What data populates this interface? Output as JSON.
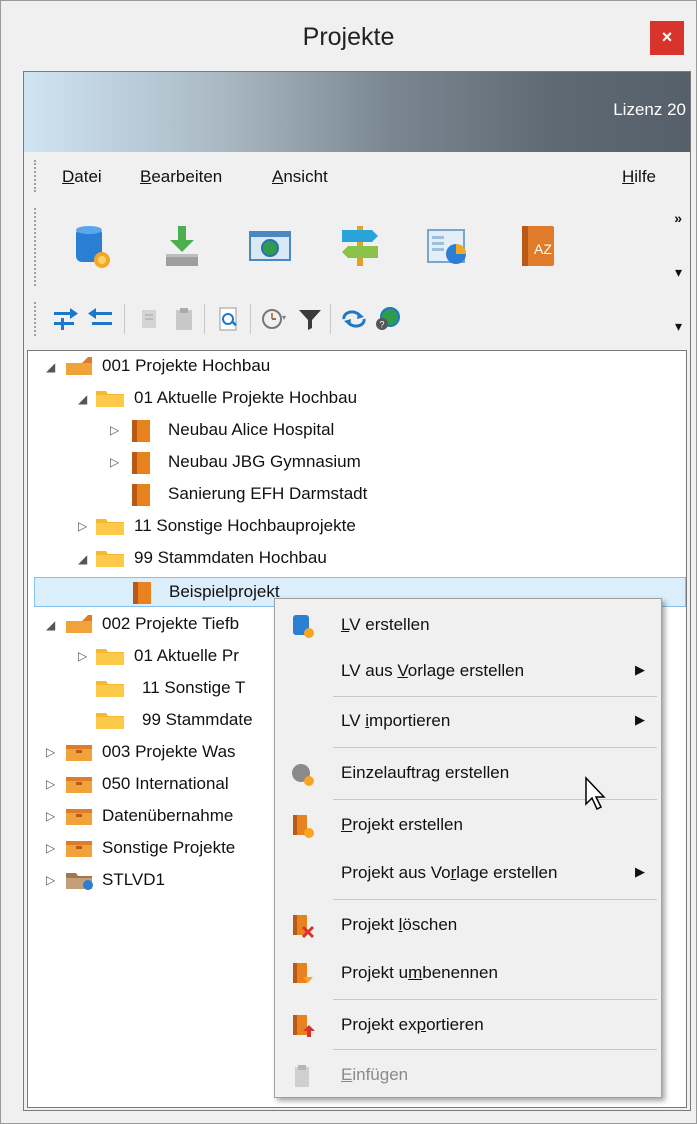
{
  "window": {
    "title": "Projekte",
    "close_glyph": "×"
  },
  "banner": {
    "text": "Lizenz 20"
  },
  "menu": {
    "datei": {
      "u": "D",
      "rest": "atei"
    },
    "bearbeiten": {
      "u": "B",
      "rest": "earbeiten"
    },
    "ansicht": {
      "u": "A",
      "rest": "nsicht"
    },
    "hilfe": {
      "u": "H",
      "rest": "ilfe"
    }
  },
  "toolbar": {
    "overflow": "»",
    "dropdown": "▾"
  },
  "tree": {
    "nodes": [
      {
        "label": "001 Projekte Hochbau"
      },
      {
        "label": "01 Aktuelle Projekte Hochbau"
      },
      {
        "label": "Neubau Alice Hospital"
      },
      {
        "label": "Neubau JBG Gymnasium"
      },
      {
        "label": "Sanierung EFH Darmstadt"
      },
      {
        "label": "11 Sonstige Hochbauprojekte"
      },
      {
        "label": "99 Stammdaten Hochbau"
      },
      {
        "label": "Beispielprojekt"
      },
      {
        "label": "002 Projekte Tiefb"
      },
      {
        "label": "01 Aktuelle Pr"
      },
      {
        "label": "11 Sonstige T"
      },
      {
        "label": "99 Stammdate"
      },
      {
        "label": "003 Projekte Was"
      },
      {
        "label": "050 International"
      },
      {
        "label": "Datenübernahme"
      },
      {
        "label": "Sonstige Projekte"
      },
      {
        "label": "STLVD1"
      }
    ]
  },
  "context_menu": {
    "items": [
      {
        "pre": "",
        "u": "L",
        "post": "V erstellen"
      },
      {
        "pre": "LV aus ",
        "u": "V",
        "post": "orlage erstellen"
      },
      {
        "pre": "LV ",
        "u": "i",
        "post": "mportieren"
      },
      {
        "pre": "Einzelauftrag erstellen",
        "u": "",
        "post": ""
      },
      {
        "pre": "",
        "u": "P",
        "post": "rojekt erstellen"
      },
      {
        "pre": "Projekt aus Vo",
        "u": "r",
        "post": "lage erstellen"
      },
      {
        "pre": "Projekt ",
        "u": "l",
        "post": "öschen"
      },
      {
        "pre": "Projekt u",
        "u": "m",
        "post": "benennen"
      },
      {
        "pre": "Projekt ex",
        "u": "p",
        "post": "ortieren"
      },
      {
        "pre": "",
        "u": "E",
        "post": "infügen"
      }
    ],
    "submenu_arrow": "▶"
  },
  "colors": {
    "close": "#d9342b",
    "folder": "#f5b82e",
    "project": "#e8821e",
    "selection": "#dbeefb",
    "banner_dark": "#55606a"
  }
}
